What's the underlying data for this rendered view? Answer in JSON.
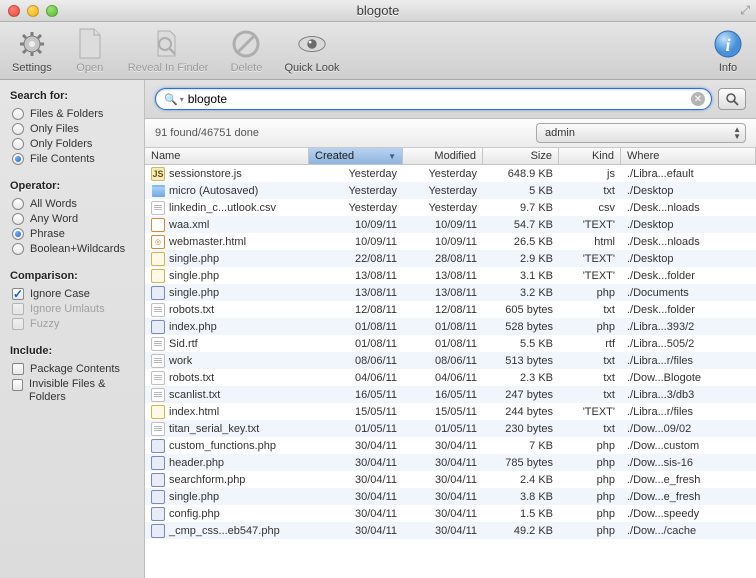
{
  "window": {
    "title": "blogote"
  },
  "toolbar": {
    "settings": "Settings",
    "open": "Open",
    "reveal": "Reveal In Finder",
    "delete": "Delete",
    "quicklook": "Quick Look",
    "info": "Info"
  },
  "sidebar": {
    "search_for": "Search for:",
    "search_options": [
      "Files & Folders",
      "Only Files",
      "Only Folders",
      "File Contents"
    ],
    "search_selected": 3,
    "operator": "Operator:",
    "operator_options": [
      "All Words",
      "Any Word",
      "Phrase",
      "Boolean+Wildcards"
    ],
    "operator_selected": 2,
    "comparison": "Comparison:",
    "ignore_case": "Ignore Case",
    "ignore_umlauts": "Ignore Umlauts",
    "fuzzy": "Fuzzy",
    "include": "Include:",
    "package_contents": "Package Contents",
    "invisible": "Invisible Files & Folders"
  },
  "search": {
    "value": "blogote"
  },
  "status": {
    "text": "91 found/46751 done",
    "scope": "admin"
  },
  "columns": {
    "name": "Name",
    "created": "Created",
    "modified": "Modified",
    "size": "Size",
    "kind": "Kind",
    "where": "Where"
  },
  "files": [
    {
      "icon": "js",
      "name": "sessionstore.js",
      "created": "Yesterday",
      "modified": "Yesterday",
      "size": "648.9 KB",
      "kind": "js",
      "where": "./Libra...efault"
    },
    {
      "icon": "folder",
      "name": "micro (Autosaved)",
      "created": "Yesterday",
      "modified": "Yesterday",
      "size": "5 KB",
      "kind": "txt",
      "where": "./Desktop"
    },
    {
      "icon": "csv",
      "name": "linkedin_c...utlook.csv",
      "created": "Yesterday",
      "modified": "Yesterday",
      "size": "9.7 KB",
      "kind": "csv",
      "where": "./Desk...nloads"
    },
    {
      "icon": "xml",
      "name": "waa.xml",
      "created": "10/09/11",
      "modified": "10/09/11",
      "size": "54.7 KB",
      "kind": "'TEXT'",
      "where": "./Desktop"
    },
    {
      "icon": "html",
      "name": "webmaster.html",
      "created": "10/09/11",
      "modified": "10/09/11",
      "size": "26.5 KB",
      "kind": "html",
      "where": "./Desk...nloads"
    },
    {
      "icon": "text",
      "name": "single.php",
      "created": "22/08/11",
      "modified": "28/08/11",
      "size": "2.9 KB",
      "kind": "'TEXT'",
      "where": "./Desktop"
    },
    {
      "icon": "text",
      "name": "single.php",
      "created": "13/08/11",
      "modified": "13/08/11",
      "size": "3.1 KB",
      "kind": "'TEXT'",
      "where": "./Desk...folder"
    },
    {
      "icon": "php",
      "name": "single.php",
      "created": "13/08/11",
      "modified": "13/08/11",
      "size": "3.2 KB",
      "kind": "php",
      "where": "./Documents"
    },
    {
      "icon": "txt",
      "name": "robots.txt",
      "created": "12/08/11",
      "modified": "12/08/11",
      "size": "605 bytes",
      "kind": "txt",
      "where": "./Desk...folder"
    },
    {
      "icon": "php",
      "name": "index.php",
      "created": "01/08/11",
      "modified": "01/08/11",
      "size": "528 bytes",
      "kind": "php",
      "where": "./Libra...393/2"
    },
    {
      "icon": "rtf",
      "name": "Sid.rtf",
      "created": "01/08/11",
      "modified": "01/08/11",
      "size": "5.5 KB",
      "kind": "rtf",
      "where": "./Libra...505/2"
    },
    {
      "icon": "txt",
      "name": "work",
      "created": "08/06/11",
      "modified": "08/06/11",
      "size": "513 bytes",
      "kind": "txt",
      "where": "./Libra...r/files"
    },
    {
      "icon": "txt",
      "name": "robots.txt",
      "created": "04/06/11",
      "modified": "04/06/11",
      "size": "2.3 KB",
      "kind": "txt",
      "where": "./Dow...Blogote"
    },
    {
      "icon": "txt",
      "name": "scanlist.txt",
      "created": "16/05/11",
      "modified": "16/05/11",
      "size": "247 bytes",
      "kind": "txt",
      "where": "./Libra...3/db3"
    },
    {
      "icon": "text",
      "name": "index.html",
      "created": "15/05/11",
      "modified": "15/05/11",
      "size": "244 bytes",
      "kind": "'TEXT'",
      "where": "./Libra...r/files"
    },
    {
      "icon": "txt",
      "name": "titan_serial_key.txt",
      "created": "01/05/11",
      "modified": "01/05/11",
      "size": "230 bytes",
      "kind": "txt",
      "where": "./Dow...09/02"
    },
    {
      "icon": "php",
      "name": "custom_functions.php",
      "created": "30/04/11",
      "modified": "30/04/11",
      "size": "7 KB",
      "kind": "php",
      "where": "./Dow...custom"
    },
    {
      "icon": "php",
      "name": "header.php",
      "created": "30/04/11",
      "modified": "30/04/11",
      "size": "785 bytes",
      "kind": "php",
      "where": "./Dow...sis-16"
    },
    {
      "icon": "php",
      "name": "searchform.php",
      "created": "30/04/11",
      "modified": "30/04/11",
      "size": "2.4 KB",
      "kind": "php",
      "where": "./Dow...e_fresh"
    },
    {
      "icon": "php",
      "name": "single.php",
      "created": "30/04/11",
      "modified": "30/04/11",
      "size": "3.8 KB",
      "kind": "php",
      "where": "./Dow...e_fresh"
    },
    {
      "icon": "php",
      "name": "config.php",
      "created": "30/04/11",
      "modified": "30/04/11",
      "size": "1.5 KB",
      "kind": "php",
      "where": "./Dow...speedy"
    },
    {
      "icon": "php",
      "name": "_cmp_css...eb547.php",
      "created": "30/04/11",
      "modified": "30/04/11",
      "size": "49.2 KB",
      "kind": "php",
      "where": "./Dow.../cache"
    }
  ]
}
